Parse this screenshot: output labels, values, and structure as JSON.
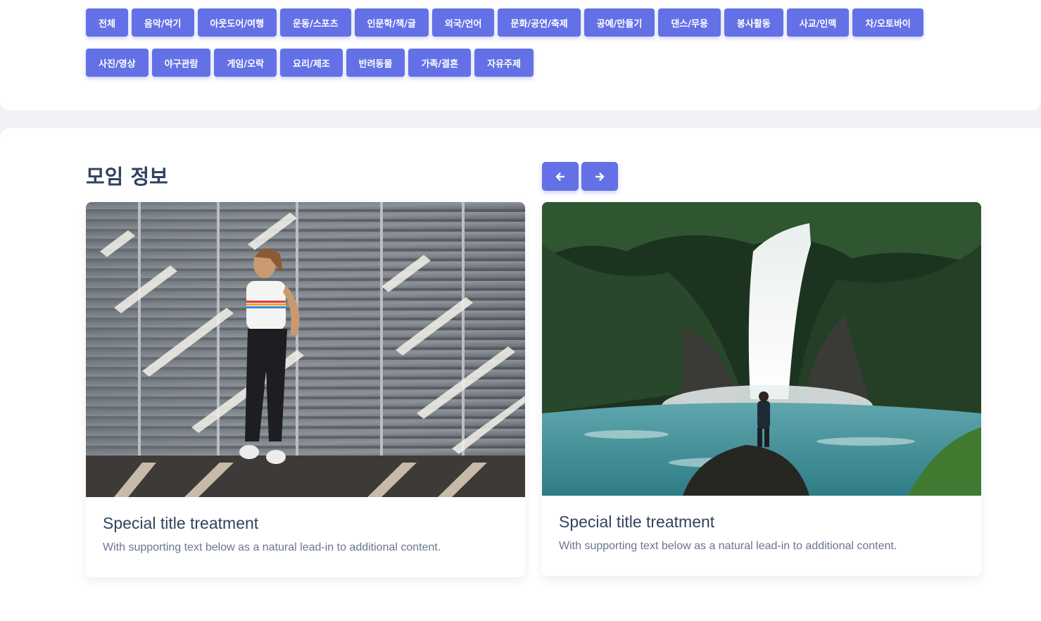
{
  "categories": [
    "전체",
    "음악/악기",
    "아웃도어/여행",
    "운동/스포츠",
    "인문학/책/글",
    "외국/언어",
    "문화/공연/축제",
    "공예/만들기",
    "댄스/무용",
    "봉사활동",
    "사교/인맥",
    "차/오토바이",
    "사진/영상",
    "야구관람",
    "게임/오락",
    "요리/제조",
    "반려동물",
    "가족/결혼",
    "자유주제"
  ],
  "section": {
    "title": "모임 정보"
  },
  "cards": [
    {
      "title": "Special title treatment",
      "text": "With supporting text below as a natural lead-in to additional content."
    },
    {
      "title": "Special title treatment",
      "text": "With supporting text below as a natural lead-in to additional content."
    }
  ],
  "icons": {
    "prev": "arrow-left-icon",
    "next": "arrow-right-icon"
  },
  "colors": {
    "accent": "#6471e6",
    "heading": "#334260",
    "muted": "#6b7590",
    "page_bg": "#f1f2f5"
  }
}
